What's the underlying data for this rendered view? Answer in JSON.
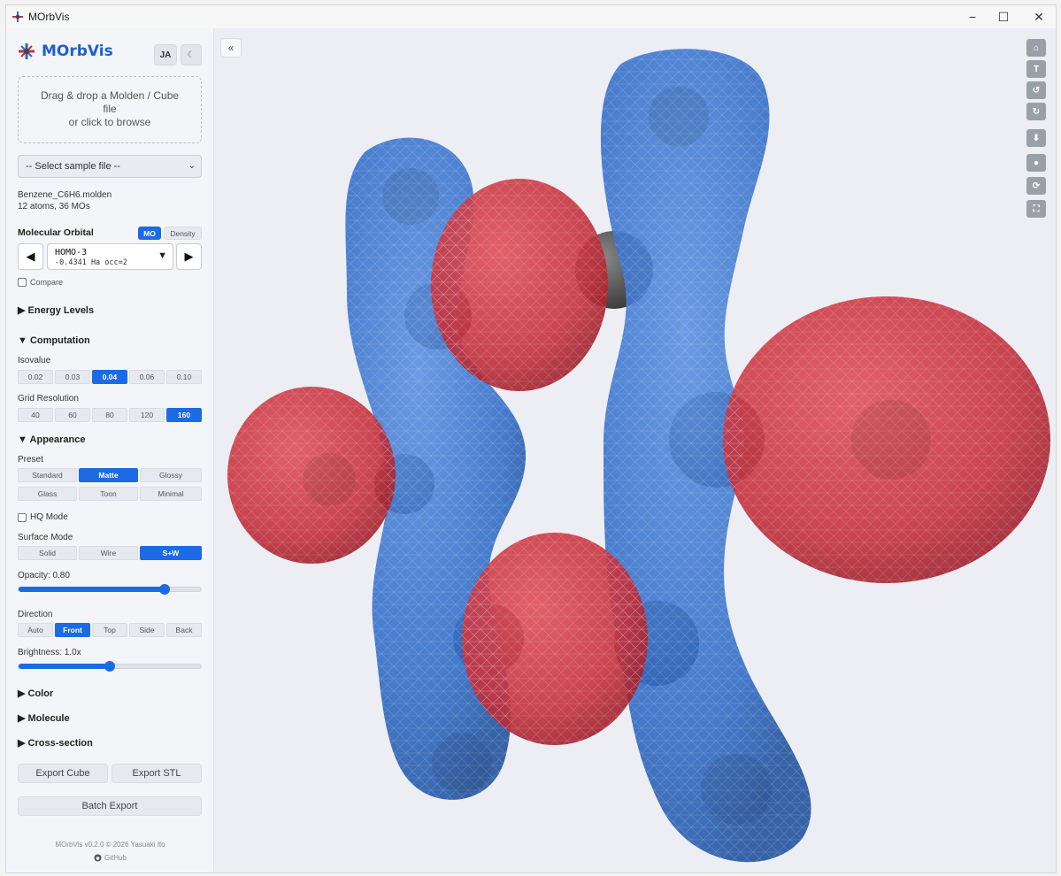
{
  "window": {
    "title": "MOrbVis",
    "minimize": "−",
    "maximize": "☐",
    "close": "✕"
  },
  "header": {
    "brand": "MOrbVis",
    "lang_button": "JA",
    "theme_button": "☾"
  },
  "upload": {
    "line1": "Drag & drop a Molden / Cube",
    "line2": "file",
    "line3": "or click to browse"
  },
  "sample_select": {
    "value": "-- Select sample file --"
  },
  "file_info": {
    "name": "Benzene_C6H6.molden",
    "stats": "12 atoms, 36 MOs"
  },
  "orbital": {
    "label": "Molecular Orbital",
    "mode_mo": "MO",
    "mode_density": "Density",
    "prev": "◀",
    "next": "▶",
    "name": "HOMO-3",
    "detail": "-0.4341 Ha occ=2",
    "compare": "Compare"
  },
  "sections": {
    "energy_levels": "▶ Energy Levels",
    "computation": "▼ Computation",
    "appearance": "▼ Appearance",
    "color": "▶ Color",
    "molecule": "▶ Molecule",
    "cross_section": "▶ Cross-section"
  },
  "computation": {
    "isovalue_label": "Isovalue",
    "isovalues": [
      "0.02",
      "0.03",
      "0.04",
      "0.06",
      "0.10"
    ],
    "isovalue_selected": 2,
    "grid_label": "Grid Resolution",
    "grids": [
      "40",
      "60",
      "80",
      "120",
      "160"
    ],
    "grid_selected": 4
  },
  "appearance": {
    "preset_label": "Preset",
    "presets_row1": [
      "Standard",
      "Matte",
      "Glossy"
    ],
    "presets_row2": [
      "Glass",
      "Toon",
      "Minimal"
    ],
    "hq_mode": "HQ Mode",
    "surface_label": "Surface Mode",
    "surface_modes": [
      "Solid",
      "Wire",
      "S+W"
    ],
    "opacity_label": "Opacity: 0.80",
    "opacity_value": 0.8,
    "direction_label": "Direction",
    "directions": [
      "Auto",
      "Front",
      "Top",
      "Side",
      "Back"
    ],
    "brightness_label": "Brightness: 1.0x",
    "brightness_fraction": 0.5
  },
  "export": {
    "cube": "Export Cube",
    "stl": "Export STL",
    "batch": "Batch Export"
  },
  "footer": {
    "version": "MOrbVis v0.2.0 © 2026 Yasuaki Ito",
    "github": "GitHub"
  },
  "viewport": {
    "collapse": "«",
    "toolbar": [
      "⌂",
      "T",
      "↺",
      "↻",
      "⬇",
      "●",
      "⟳",
      "⛶"
    ]
  },
  "colors": {
    "accent": "#1d6ae5",
    "positive_lobe": "#c5323e",
    "negative_lobe": "#2f6bc7",
    "atom": "#555555"
  }
}
